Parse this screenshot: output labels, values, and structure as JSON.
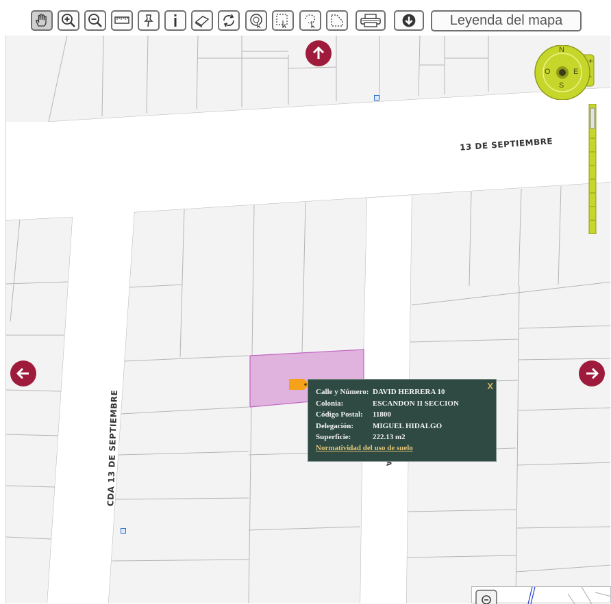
{
  "toolbar": {
    "tools": [
      {
        "name": "pan-tool-button",
        "icon": "hand-icon",
        "active": true
      },
      {
        "name": "zoom-in-button",
        "icon": "zoom-in-icon"
      },
      {
        "name": "zoom-out-button",
        "icon": "zoom-out-icon"
      },
      {
        "name": "measure-button",
        "icon": "ruler-icon"
      },
      {
        "name": "pin-button",
        "icon": "pushpin-icon"
      },
      {
        "name": "info-button",
        "icon": "info-icon"
      },
      {
        "name": "eraser-button",
        "icon": "eraser-icon"
      },
      {
        "name": "refresh-button",
        "icon": "refresh-icon"
      },
      {
        "name": "circle-select-button",
        "icon": "circle-select-icon"
      },
      {
        "name": "rect-select-button",
        "icon": "rect-select-icon"
      },
      {
        "name": "lasso-select-button",
        "icon": "lasso-select-icon"
      },
      {
        "name": "polygon-select-button",
        "icon": "polygon-select-icon"
      },
      {
        "name": "print-button",
        "icon": "printer-icon"
      },
      {
        "name": "download-button",
        "icon": "download-icon"
      }
    ],
    "legend_label": "Leyenda del mapa"
  },
  "map": {
    "streets": {
      "main": "13 DE SEPTIEMBRE",
      "secondary": "CDA 13 DE SEPTIEMBRE",
      "partial": "A"
    },
    "compass": {
      "n": "N",
      "s": "S",
      "e": "E",
      "w": "O",
      "zoom_in": "+",
      "zoom_out": "-"
    },
    "colors": {
      "pan_button": "#9e1b3c",
      "selected_parcel": "#e0b3df",
      "popup_bg": "#2e4a42",
      "compass": "#c7d62a"
    }
  },
  "popup": {
    "close": "X",
    "rows": [
      {
        "label": "Calle y Número:",
        "value": "DAVID HERRERA 10"
      },
      {
        "label": "Colonia:",
        "value": "ESCANDON II SECCION"
      },
      {
        "label": "Código Postal:",
        "value": "11800"
      },
      {
        "label": "Delegación:",
        "value": "MIGUEL HIDALGO"
      },
      {
        "label": "Superficie:",
        "value": "222.13 m2"
      }
    ],
    "link": "Normatividad del uso de suelo"
  }
}
